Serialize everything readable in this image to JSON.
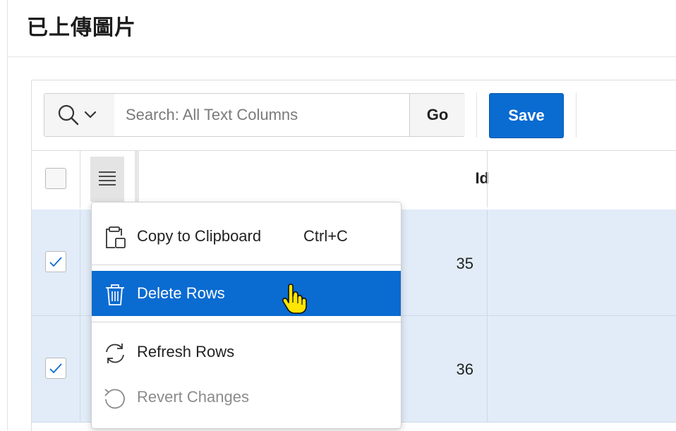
{
  "region": {
    "title": "已上傳圖片"
  },
  "toolbar": {
    "search_placeholder": "Search: All Text Columns",
    "go_label": "Go",
    "save_label": "Save"
  },
  "grid": {
    "columns": [
      {
        "label": "Id"
      }
    ],
    "rows": [
      {
        "id": "35",
        "selected": true
      },
      {
        "id": "36",
        "selected": true
      }
    ]
  },
  "context_menu": {
    "items": [
      {
        "label": "Copy to Clipboard",
        "shortcut": "Ctrl+C",
        "icon": "clipboard-icon"
      },
      {
        "label": "Delete Rows",
        "icon": "trash-icon",
        "state": "hover"
      },
      {
        "label": "Refresh Rows",
        "icon": "refresh-icon"
      },
      {
        "label": "Revert Changes",
        "icon": "undo-icon",
        "state": "disabled"
      }
    ]
  },
  "colors": {
    "accent": "#0a6bd1",
    "selected_row": "#e1ecf8",
    "menu_hover": "#0a6bd1"
  }
}
